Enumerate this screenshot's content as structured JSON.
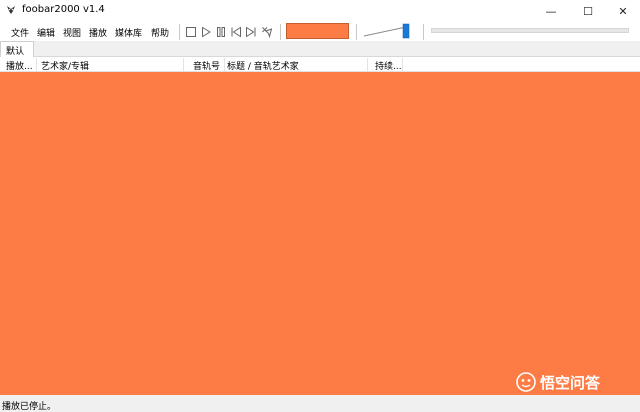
{
  "window": {
    "title": "foobar2000 v1.4",
    "minimize_glyph": "—",
    "maximize_glyph": "☐",
    "close_glyph": "✕"
  },
  "menu": {
    "items": [
      {
        "label": "文件"
      },
      {
        "label": "编辑"
      },
      {
        "label": "视图"
      },
      {
        "label": "播放"
      },
      {
        "label": "媒体库"
      },
      {
        "label": "帮助"
      }
    ]
  },
  "toolbar": {
    "buttons": [
      {
        "icon": "stop-icon"
      },
      {
        "icon": "play-icon"
      },
      {
        "icon": "pause-icon"
      },
      {
        "icon": "previous-icon"
      },
      {
        "icon": "next-icon"
      },
      {
        "icon": "random-icon"
      }
    ],
    "visualization_color": "#fd7c45",
    "volume_level": 1.0
  },
  "tabs": [
    {
      "label": "默认"
    }
  ],
  "playlist": {
    "columns": [
      {
        "label": "播放..."
      },
      {
        "label": "艺术家/专辑"
      },
      {
        "label": "音轨号"
      },
      {
        "label": "标题 / 音轨艺术家"
      },
      {
        "label": "持续..."
      }
    ],
    "background_color": "#fd7c45"
  },
  "status": {
    "text": "播放已停止。"
  },
  "watermark": {
    "text": "悟空问答"
  }
}
